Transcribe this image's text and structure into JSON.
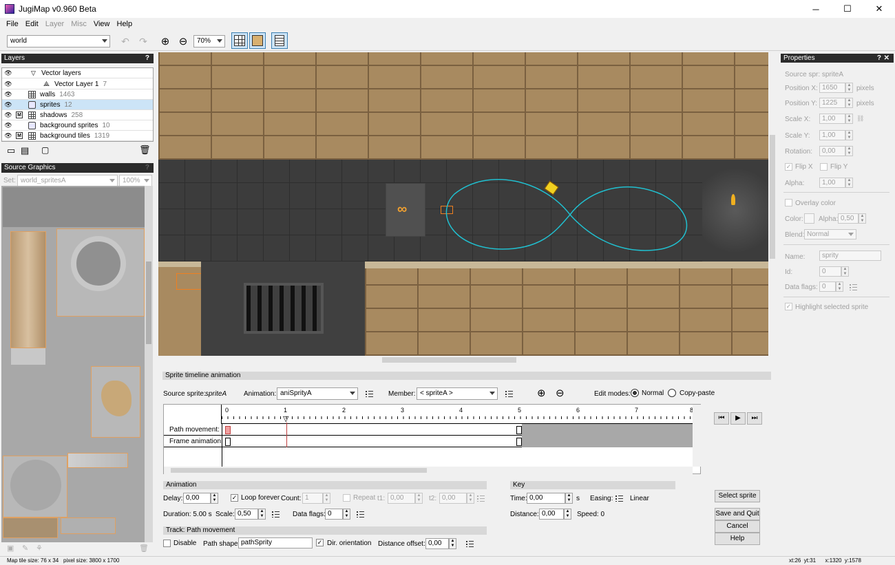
{
  "window": {
    "title": "JugiMap v0.960 Beta",
    "minimize": "─",
    "maximize": "☐",
    "close": "✕"
  },
  "menu": [
    "File",
    "Edit",
    "Layer",
    "Misc",
    "View",
    "Help"
  ],
  "toolbar": {
    "world_select": "world",
    "zoom": "70%",
    "icons": [
      "undo-icon",
      "redo-icon",
      "zoom-in-icon",
      "zoom-out-icon",
      "grid-icon",
      "sprite-frame-icon",
      "panel-icon"
    ]
  },
  "layers_panel": {
    "title": "Layers",
    "help": "?",
    "items": [
      {
        "name": "Vector layers",
        "count": "",
        "type": "group"
      },
      {
        "name": "Vector Layer 1",
        "count": "7",
        "type": "vector"
      },
      {
        "name": "walls",
        "count": "1463",
        "type": "tile"
      },
      {
        "name": "sprites",
        "count": "12",
        "type": "sprite",
        "selected": true
      },
      {
        "name": "shadows",
        "count": "258",
        "type": "tile"
      },
      {
        "name": "background sprites",
        "count": "10",
        "type": "sprite"
      },
      {
        "name": "background tiles",
        "count": "1319",
        "type": "tile"
      }
    ],
    "m_flag": "M"
  },
  "source_panel": {
    "title": "Source Graphics",
    "help": "?",
    "set_label": "Set:",
    "set_value": "world_spritesA",
    "zoom": "100%"
  },
  "properties": {
    "title": "Properties",
    "help": "?",
    "close": "✕",
    "source_sprite": "Source spr: spriteA",
    "position_x_label": "Position X:",
    "position_x": "1650",
    "position_unit_x": "pixels",
    "position_y_label": "Position Y:",
    "position_y": "1225",
    "position_unit_y": "pixels",
    "scale_x_label": "Scale X:",
    "scale_x": "1,00",
    "scale_y_label": "Scale Y:",
    "scale_y": "1,00",
    "rotation_label": "Rotation:",
    "rotation": "0,00",
    "flip_x": "Flip X",
    "flip_y": "Flip Y",
    "alpha_label": "Alpha:",
    "alpha": "1,00",
    "overlay_color": "Overlay color",
    "color_label": "Color:",
    "overlay_alpha_label": "Alpha:",
    "overlay_alpha": "0,50",
    "blend_label": "Blend:",
    "blend": "Normal",
    "name_label": "Name:",
    "name": "sprity",
    "id_label": "Id:",
    "id": "0",
    "data_flags_label": "Data flags:",
    "data_flags": "0",
    "highlight": "Highlight selected sprite"
  },
  "timeline": {
    "section_title": "Sprite timeline animation",
    "source_sprite_label": "Source sprite:",
    "source_sprite": "spriteA",
    "animation_label": "Animation:",
    "animation": "aniSprityA",
    "member_label": "Member:",
    "member": "< spriteA >",
    "edit_modes_label": "Edit modes:",
    "mode_normal": "Normal",
    "mode_copy": "Copy-paste",
    "ruler": [
      "0",
      "1",
      "2",
      "3",
      "4",
      "5",
      "6",
      "7",
      "8"
    ],
    "tracks": [
      "Path movement:",
      "Frame animation:"
    ],
    "transport": [
      "⏮",
      "▶",
      "⏭"
    ]
  },
  "animation": {
    "title": "Animation",
    "delay_label": "Delay:",
    "delay": "0,00",
    "loop_forever": "Loop forever",
    "count_label": "Count:",
    "count": "1",
    "repeat": "Repeat",
    "t1_label": "t1:",
    "t1": "0,00",
    "t2_label": "t2:",
    "t2": "0,00",
    "duration": "Duration: 5.00 s",
    "scale_label": "Scale:",
    "scale": "0,50",
    "data_flags_label": "Data flags:",
    "data_flags": "0"
  },
  "track": {
    "title": "Track: Path movement",
    "disable": "Disable",
    "path_shape_label": "Path shape:",
    "path_shape": "pathSprity",
    "dir_orientation": "Dir. orientation",
    "distance_offset_label": "Distance offset:",
    "distance_offset": "0,00"
  },
  "key": {
    "title": "Key",
    "time_label": "Time:",
    "time": "0,00",
    "time_unit": "s",
    "easing_label": "Easing:",
    "easing": "Linear",
    "distance_label": "Distance:",
    "distance": "0,00",
    "speed": "Speed: 0"
  },
  "buttons": {
    "select_sprite": "Select sprite",
    "save_quit": "Save and Quit",
    "cancel": "Cancel",
    "help": "Help"
  },
  "status": {
    "map_tile_size": "Map tile size: 76 x 34",
    "pixel_size": "pixel size: 3800 x 1700",
    "coords": "xt:26  yt:31      x:1320  y:1578"
  }
}
